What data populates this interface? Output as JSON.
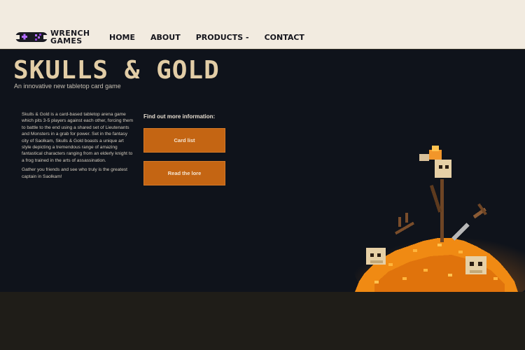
{
  "header": {
    "logo": {
      "line1": "WRENCH",
      "line2": "GAMES"
    },
    "nav": [
      {
        "label": "HOME"
      },
      {
        "label": "ABOUT"
      },
      {
        "label": "PRODUCTS -"
      },
      {
        "label": "CONTACT"
      }
    ]
  },
  "hero": {
    "title": "SKULLS & GOLD",
    "subtitle": "An innovative new tabletop card game",
    "description": [
      "Skulls & Gold is a card-based tabletop arena game which pits 3-5 players against each other, forcing them to battle to the end using a shared set of Lieutenants and Monsters in a grab for power. Set in the fantasy city of Saolkam, Skulls & Gold boasts a unique art style depicting a tremendous range of amazing fantastical characters ranging from an elderly knight to a frog trained in the arts of assassination.",
      "Gather you friends and see who truly is the greatest captain in Saolkam!"
    ],
    "info_heading": "Find out more information:",
    "buttons": {
      "card_list": "Card list",
      "lore": "Read the lore"
    }
  },
  "colors": {
    "header_bg": "#f2ebe0",
    "hero_bg": "#0f131b",
    "footer_bg": "#1f1d18",
    "title": "#e2cda6",
    "button": "#c46513",
    "logo_accent": "#8a3fd1"
  }
}
